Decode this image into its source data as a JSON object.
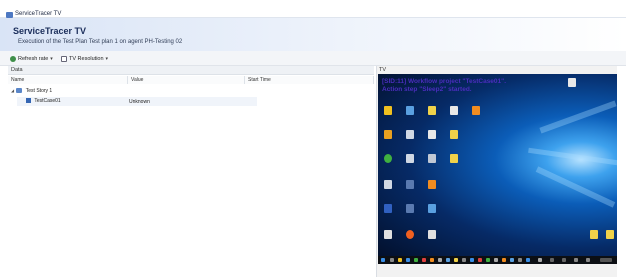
{
  "window": {
    "title": "ServiceTracer TV"
  },
  "header": {
    "title": "ServiceTracer TV",
    "subtitle": "Execution of the Test Plan Test plan 1 on agent PH-Testing 02"
  },
  "toolbar": {
    "refresh_label": "Refresh rate",
    "resolution_label": "TV Resolution"
  },
  "data_section": {
    "title": "Data",
    "columns": [
      "Name",
      "Value",
      "Start Time"
    ],
    "rows": [
      {
        "name": "Test Story 1",
        "value": "",
        "start_time": ""
      },
      {
        "name": "TestCase01",
        "value": "Unknown",
        "start_time": ""
      }
    ]
  },
  "tv_section": {
    "title": "TV",
    "overlay_line1": "[SID:11] Workflow project \"TestCase01\".",
    "overlay_line2": "Action step \"Sleep2\" started."
  },
  "colors": {
    "header_bg": "#d9e4f6",
    "overlay_text": "#4a2dbd",
    "desktop_blue": "#0b5db8"
  }
}
